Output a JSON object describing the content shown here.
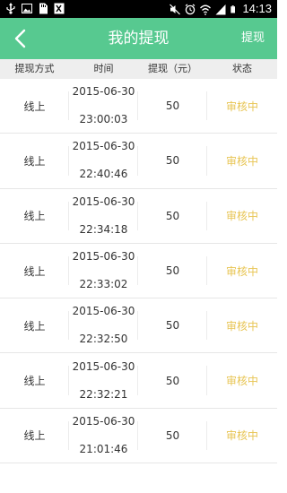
{
  "statusbar": {
    "time": "14:13"
  },
  "appbar": {
    "title": "我的提现",
    "action_label": "提现"
  },
  "table": {
    "headers": [
      "提现方式",
      "时间",
      "提现（元）",
      "状态"
    ],
    "rows": [
      {
        "method": "线上",
        "date": "2015-06-30",
        "time": "23:00:03",
        "amount": "50",
        "status": "审核中"
      },
      {
        "method": "线上",
        "date": "2015-06-30",
        "time": "22:40:46",
        "amount": "50",
        "status": "审核中"
      },
      {
        "method": "线上",
        "date": "2015-06-30",
        "time": "22:34:18",
        "amount": "50",
        "status": "审核中"
      },
      {
        "method": "线上",
        "date": "2015-06-30",
        "time": "22:33:02",
        "amount": "50",
        "status": "审核中"
      },
      {
        "method": "线上",
        "date": "2015-06-30",
        "time": "22:32:50",
        "amount": "50",
        "status": "审核中"
      },
      {
        "method": "线上",
        "date": "2015-06-30",
        "time": "22:32:21",
        "amount": "50",
        "status": "审核中"
      },
      {
        "method": "线上",
        "date": "2015-06-30",
        "time": "21:01:46",
        "amount": "50",
        "status": "审核中"
      }
    ]
  },
  "colors": {
    "header_bg": "#57c990",
    "status_pending": "#e8c553",
    "column_header_bg": "#eeeeee"
  }
}
